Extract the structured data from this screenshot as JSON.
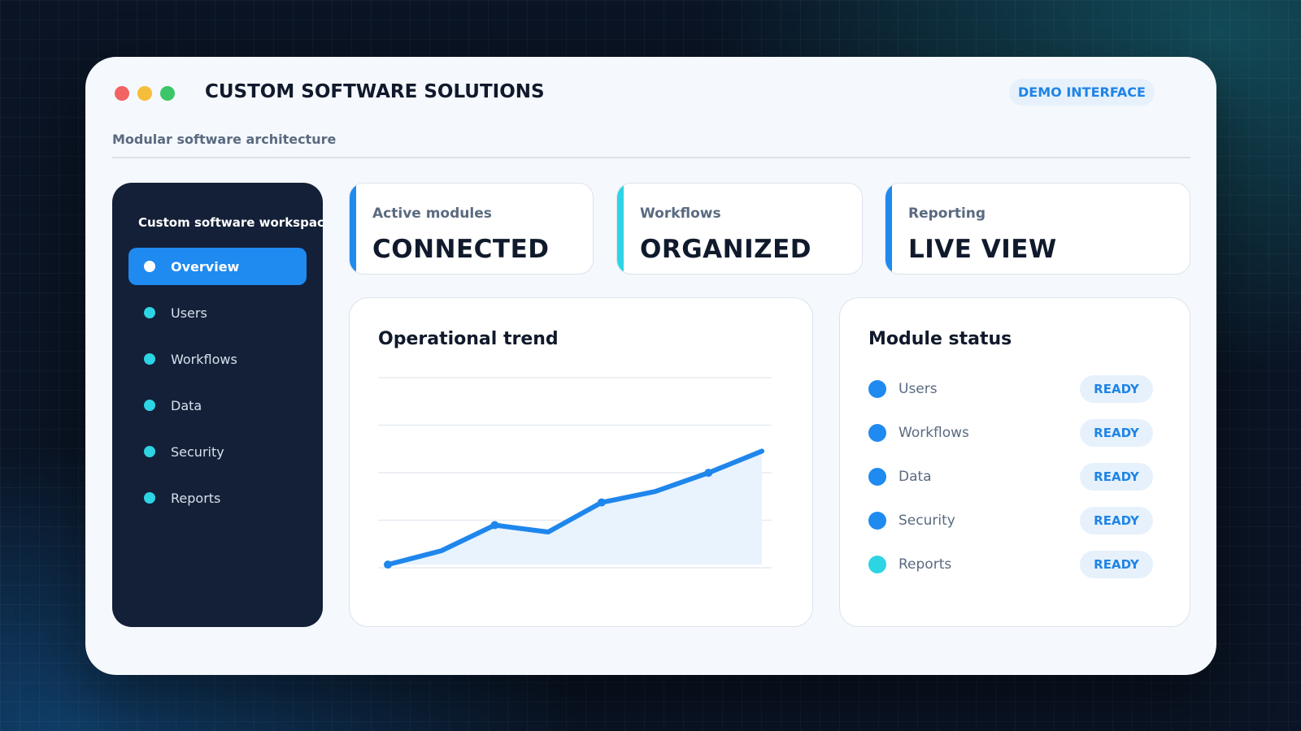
{
  "window": {
    "title": "CUSTOM SOFTWARE SOLUTIONS",
    "badge": "DEMO INTERFACE",
    "subtitle": "Modular software architecture"
  },
  "sidebar": {
    "heading": "Custom software workspace",
    "items": [
      {
        "label": "Overview",
        "active": true
      },
      {
        "label": "Users",
        "active": false
      },
      {
        "label": "Workflows",
        "active": false
      },
      {
        "label": "Data",
        "active": false
      },
      {
        "label": "Security",
        "active": false
      },
      {
        "label": "Reports",
        "active": false
      }
    ]
  },
  "stats": [
    {
      "label": "Active modules",
      "value": "CONNECTED",
      "accent": "#1f8af0"
    },
    {
      "label": "Workflows",
      "value": "ORGANIZED",
      "accent": "#2dd4e4"
    },
    {
      "label": "Reporting",
      "value": "LIVE VIEW",
      "accent": "#1f8af0"
    }
  ],
  "trend_panel": {
    "title": "Operational trend"
  },
  "chart_data": {
    "type": "area",
    "title": "Operational trend",
    "x": [
      0,
      1,
      2,
      3,
      4,
      5,
      6,
      7
    ],
    "values": [
      0,
      1.4,
      4.0,
      3.3,
      6.3,
      7.4,
      9.3,
      11.5
    ],
    "ylim": [
      -1.8,
      19.6
    ],
    "grid": true,
    "points_marked": [
      0,
      2,
      4,
      6
    ],
    "line_color": "#1f86ec",
    "fill_color": "#e8f3fd"
  },
  "module_panel": {
    "title": "Module status",
    "rows": [
      {
        "name": "Users",
        "status": "READY",
        "color": "#1f8af0"
      },
      {
        "name": "Workflows",
        "status": "READY",
        "color": "#1f8af0"
      },
      {
        "name": "Data",
        "status": "READY",
        "color": "#1f8af0"
      },
      {
        "name": "Security",
        "status": "READY",
        "color": "#1f8af0"
      },
      {
        "name": "Reports",
        "status": "READY",
        "color": "#2dd4e4"
      }
    ]
  },
  "colors": {
    "accent": "#1f8af0",
    "teal": "#2dd4e4",
    "sidebar_bg": "#142038"
  }
}
